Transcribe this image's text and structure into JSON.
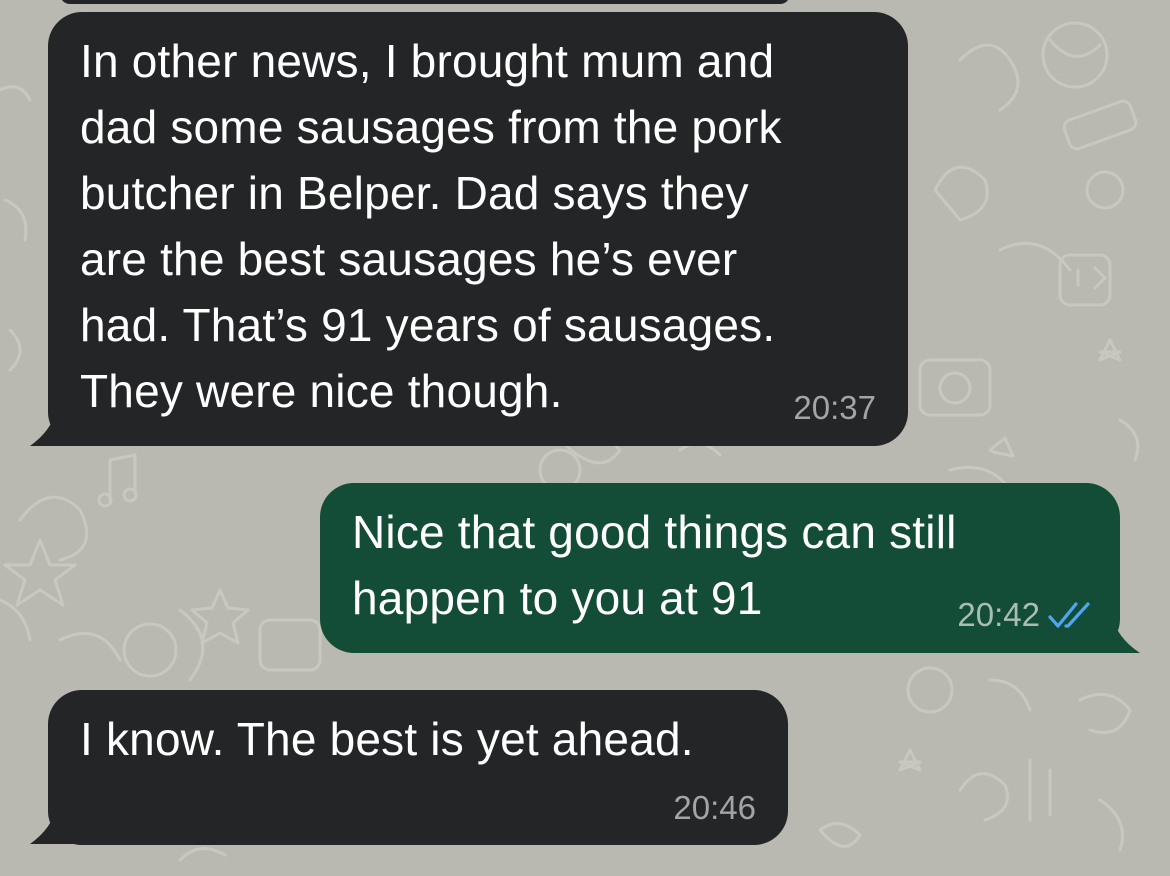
{
  "chat": {
    "wallpaper_color": "#bab9b1",
    "incoming_bubble_color": "#242527",
    "outgoing_bubble_color": "#144d37",
    "read_receipt_color": "#4fa6f0",
    "messages": [
      {
        "direction": "incoming",
        "lines": [
          "In other news, I brought mum and",
          "dad some sausages from the pork",
          "butcher in Belper. Dad says they",
          "are the best sausages he’s ever",
          "had. That’s 91 years of sausages.",
          "They were nice though."
        ],
        "time": "20:37"
      },
      {
        "direction": "outgoing",
        "lines": [
          "Nice that good things can still",
          "happen to you at 91"
        ],
        "time": "20:42",
        "status_icon": "double-check-read-icon"
      },
      {
        "direction": "incoming",
        "lines": [
          "I know. The best is yet ahead."
        ],
        "time": "20:46"
      }
    ]
  }
}
